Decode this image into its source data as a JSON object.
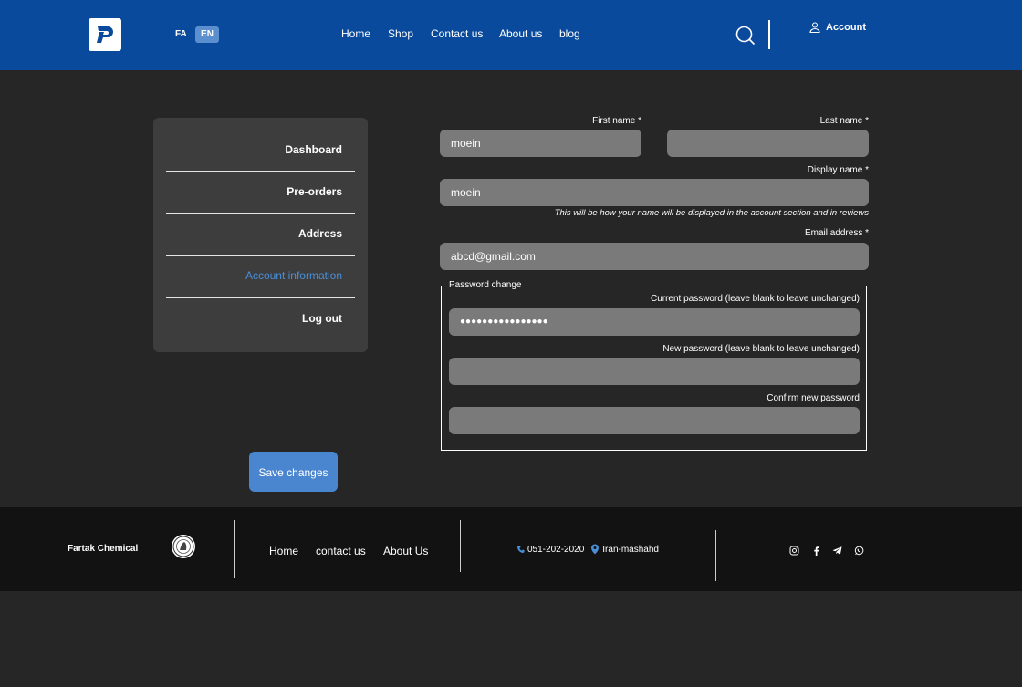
{
  "header": {
    "lang_fa": "FA",
    "lang_en": "EN",
    "nav": [
      "Home",
      "Shop",
      "Contact us",
      "About us",
      "blog"
    ],
    "account_label": "Account"
  },
  "sidebar": {
    "items": [
      {
        "label": "Dashboard"
      },
      {
        "label": "Pre-orders"
      },
      {
        "label": "Address"
      },
      {
        "label": "Account information",
        "active": true
      },
      {
        "label": "Log out"
      }
    ]
  },
  "form": {
    "first_name_label": "First name *",
    "first_name_value": "moein",
    "last_name_label": "Last name *",
    "last_name_value": "",
    "display_name_label": "Display name *",
    "display_name_value": "moein",
    "display_name_hint": "This will be how your name will be displayed in the account section and in reviews",
    "email_label": "Email address *",
    "email_value": "abcd@gmail.com",
    "password_legend": "Password change",
    "current_password_label": "Current password (leave blank to leave unchanged)",
    "current_password_value": "●●●●●●●●●●●●●●●●",
    "new_password_label": "New password (leave blank to leave unchanged)",
    "new_password_value": "",
    "confirm_password_label": "Confirm new password",
    "confirm_password_value": "",
    "save_label": "Save changes"
  },
  "footer": {
    "brand": "Fartak Chemical",
    "links": [
      "Home",
      "contact us",
      "About Us"
    ],
    "phone": "051-202-2020",
    "location": "Iran-mashahd",
    "social_icons": [
      "instagram-icon",
      "facebook-icon",
      "telegram-icon",
      "whatsapp-icon"
    ]
  },
  "colors": {
    "header_bg": "#0a4a9c",
    "page_bg": "#262626",
    "sidebar_bg": "#3d3d3d",
    "field_bg": "#7a7a7a",
    "accent": "#4a86cf",
    "active_link": "#4a8fd8",
    "footer_bg": "#121212"
  }
}
